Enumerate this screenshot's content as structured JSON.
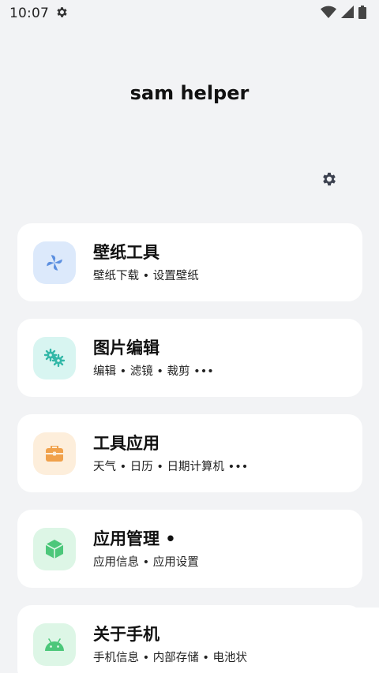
{
  "status_bar": {
    "time": "10:07",
    "icons": [
      "settings-icon",
      "wifi-icon",
      "cellular-icon",
      "battery-icon"
    ]
  },
  "app": {
    "title": "sam helper",
    "settings_icon": "gear-icon"
  },
  "cards": [
    {
      "title": "壁纸工具",
      "subtitle": "壁纸下载 • 设置壁纸",
      "icon": "pinwheel-icon",
      "icon_bg": "#dce9fb",
      "icon_color": "#5b8fe0"
    },
    {
      "title": "图片编辑",
      "subtitle": "编辑 • 滤镜 • 裁剪 •••",
      "icon": "gears-icon",
      "icon_bg": "#d8f5f1",
      "icon_color": "#33b8a8"
    },
    {
      "title": "工具应用",
      "subtitle": "天气 • 日历 • 日期计算机 •••",
      "icon": "toolbox-icon",
      "icon_bg": "#fdeedb",
      "icon_color": "#f0a14b"
    },
    {
      "title": "应用管理 •",
      "subtitle": "应用信息 • 应用设置",
      "icon": "cube-icon",
      "icon_bg": "#ddf6e6",
      "icon_color": "#4cc77a"
    },
    {
      "title": "关于手机",
      "subtitle": "手机信息 • 内部存储 • 电池状",
      "icon": "android-icon",
      "icon_bg": "#ddf6e6",
      "icon_color": "#4cc77a"
    }
  ]
}
